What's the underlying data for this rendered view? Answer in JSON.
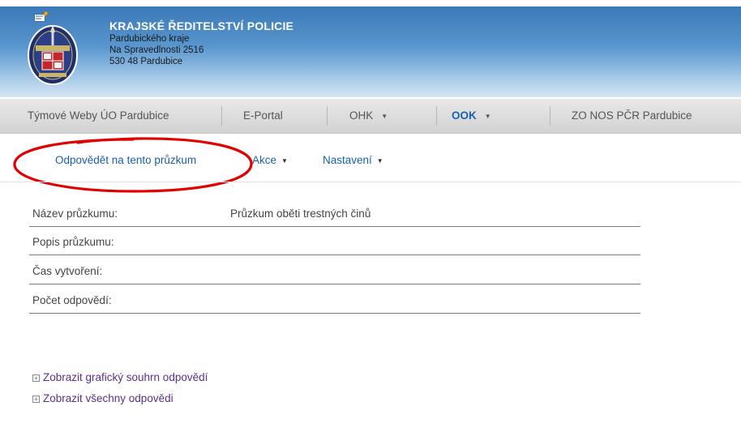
{
  "header": {
    "org_name": "KRAJSKÉ ŘEDITELSTVÍ POLICIE",
    "line1": "Pardubického kraje",
    "line2": "Na Spravedlnosti 2516",
    "line3": "530 48 Pardubice",
    "logo_icon": "police-badge-icon"
  },
  "nav": {
    "items": [
      {
        "label": "Týmové Weby ÚO Pardubice"
      },
      {
        "label": "E-Portal"
      },
      {
        "label": "OHK"
      },
      {
        "label": "OOK",
        "selected": true
      },
      {
        "label": "ZO NOS PČR Pardubice"
      }
    ]
  },
  "toolbar": {
    "respond_label": "Odpovědět na tento průzkum",
    "actions_label": "Akce",
    "settings_label": "Nastavení"
  },
  "survey": {
    "name_label": "Název průzkumu:",
    "name_value": "Průzkum oběti trestných činů",
    "description_label": "Popis průzkumu:",
    "created_label": "Čas vytvoření:",
    "count_label": "Počet odpovědí:"
  },
  "links": {
    "graphical_summary": "Zobrazit grafický souhrn odpovědí",
    "all_responses": "Zobrazit všechny odpovědi"
  },
  "colors": {
    "header_blue": "#3a78b8",
    "link_blue": "#1a5fa8",
    "link_visited": "#5b2f8a",
    "highlight_red": "#e00000"
  }
}
